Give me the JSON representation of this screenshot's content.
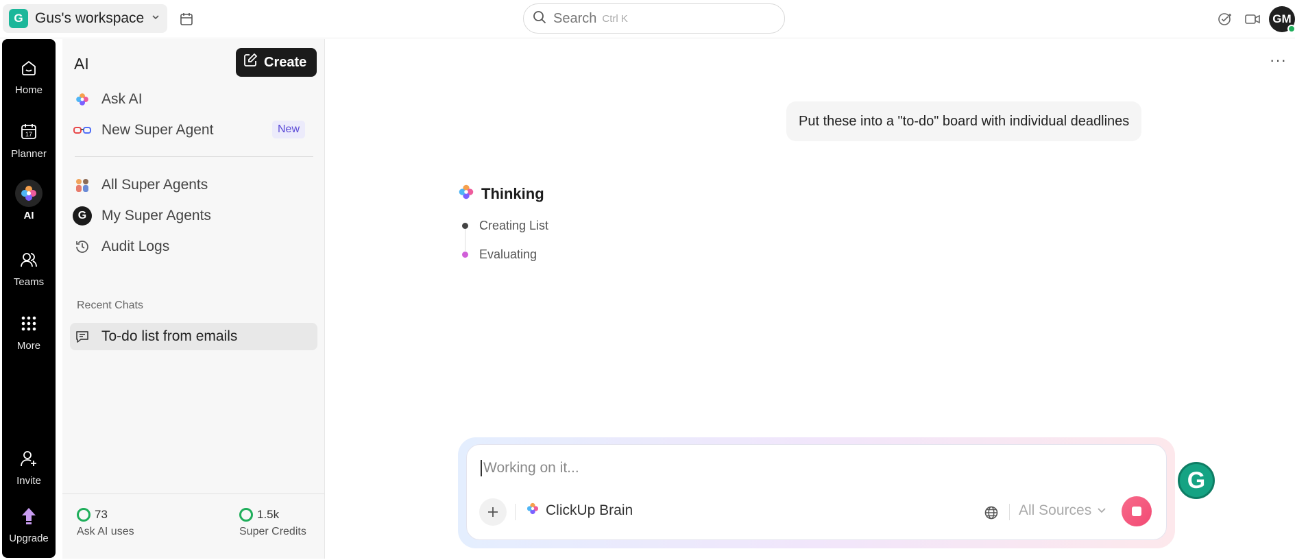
{
  "topbar": {
    "workspace_badge": "G",
    "workspace_name": "Gus's workspace",
    "search_label": "Search",
    "search_shortcut": "Ctrl K",
    "avatar_initials": "GM"
  },
  "rail": {
    "items": [
      {
        "label": "Home",
        "icon": "home-icon"
      },
      {
        "label": "Planner",
        "icon": "calendar-icon"
      },
      {
        "label": "AI",
        "icon": "ai-brain-icon"
      },
      {
        "label": "Teams",
        "icon": "teams-icon"
      },
      {
        "label": "More",
        "icon": "grid-icon"
      },
      {
        "label": "Invite",
        "icon": "add-user-icon"
      },
      {
        "label": "Upgrade",
        "icon": "upgrade-arrow-icon"
      }
    ]
  },
  "sidebar": {
    "title": "AI",
    "create_label": "Create",
    "items": [
      {
        "label": "Ask AI",
        "icon": "ai-brain-icon"
      },
      {
        "label": "New Super Agent",
        "icon": "glasses-icon",
        "badge": "New"
      },
      {
        "label": "All Super Agents",
        "icon": "agents-group-icon"
      },
      {
        "label": "My Super Agents",
        "icon": "g-avatar-icon",
        "avatar_letter": "G"
      },
      {
        "label": "Audit Logs",
        "icon": "history-icon"
      }
    ],
    "recent_section": "Recent Chats",
    "recent_chats": [
      {
        "label": "To-do list from emails",
        "icon": "chat-icon"
      }
    ],
    "footer": {
      "ask_ai_value": "73",
      "ask_ai_label": "Ask AI uses",
      "credits_value": "1.5k",
      "credits_label": "Super Credits"
    }
  },
  "main": {
    "user_message": "Put these into a \"to-do\" board with individual deadlines",
    "thinking_label": "Thinking",
    "steps": [
      "Creating List",
      "Evaluating"
    ],
    "composer": {
      "placeholder": "Working on it...",
      "model_label": "ClickUp Brain",
      "sources_label": "All Sources"
    }
  },
  "colors": {
    "accent_green": "#1bb79a",
    "rail_bg": "#000000",
    "stop_button": "#f24a74",
    "badge_purple": "#5a49d6"
  }
}
